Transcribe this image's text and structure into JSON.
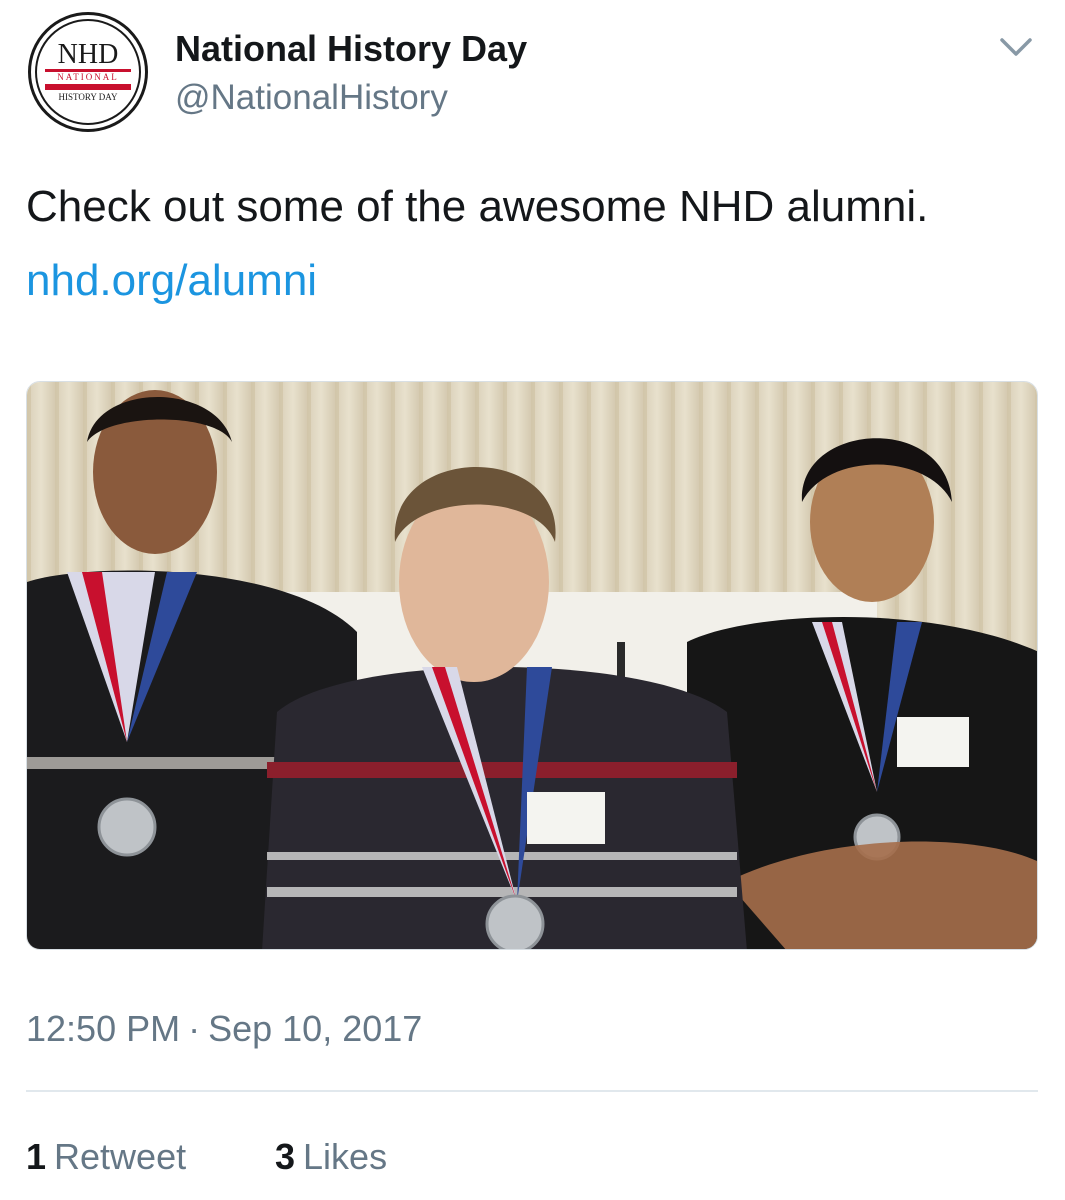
{
  "account": {
    "display_name": "National History Day",
    "handle": "@NationalHistory",
    "avatar": {
      "logo_text": "NHD",
      "logo_subtext_1": "NATIONAL",
      "logo_subtext_2": "HISTORY DAY"
    }
  },
  "menu": {
    "icon": "chevron-down-icon"
  },
  "tweet": {
    "text": "Check out some of the awesome NHD alumni.",
    "link": "nhd.org/alumni"
  },
  "meta": {
    "time": "12:50 PM",
    "separator": "·",
    "date": "Sep 10, 2017"
  },
  "stats": {
    "retweets_count": "1",
    "retweets_label": "Retweet",
    "likes_count": "3",
    "likes_label": "Likes"
  },
  "colors": {
    "link": "#1b95e0",
    "secondary_text": "#657786",
    "logo_red": "#c8102e"
  }
}
